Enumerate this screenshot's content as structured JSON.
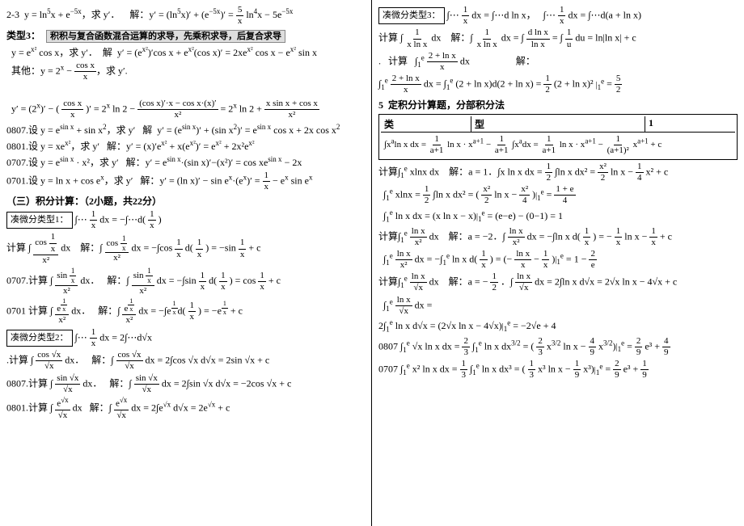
{
  "left": {
    "line1": "2-3  y = ln⁵x + e⁻⁵ˣ，求 y′．",
    "line1_ans": "解：y′ = (ln⁵x)′ + (e⁻⁵ˣ)′ = (5/x)ln⁴x − 5e⁻⁵ˣ",
    "section3_label": "类型3：",
    "section3_desc": "积积与复合函数混合运算的求导，先乘积求导，后复合求导",
    "line2": "y = eˣ² cos x，求 y′．",
    "line2_ans": "解：y′ = (eˣ²)′cos x + eˣ²(cos x)′ = 2xeˣ² cos x − eˣ² sin x",
    "line3": "其他：y = 2ˣ − cos x / x，求 y′.",
    "section_integ": "（三）积分计算：（2小题，共22分）",
    "type1_label": "凑微分类型1：",
    "type1_formula": "∫⋯(1/x)dx = −∫⋯d(1/x)",
    "calc1_q": "计算 ∫(cos(1/x)/x²)dx",
    "calc1_ans": "解：∫(cos(1/x)/x²)dx = −∫cos(1/x)d(1/x) = −sin(1/x) + c",
    "q0707": "0707.计算 ∫(sin(1/x)/x²)dx．",
    "q0707_ans": "解：∫(sin(1/x)/x²)dx = −∫sin(1/x)d(1/x) = cos(1/x) + c",
    "q0701": "0701 计算 ∫(e^(1/x)/x²)dx．",
    "q0701_ans": "解：∫(e^(1/x)/x²)dx = −∫e^(1/x)d(1/x) = −e^(1/x) + c",
    "type2_label": "凑微分类型2：",
    "type2_formula": "∫⋯(1/x)dx = 2∫⋯d√x",
    "calc2_q": "计算 ∫(cos√x/√x)dx．",
    "calc2_ans": "解：∫(cos√x/√x)dx = 2∫cos√x d√x = 2sin√x + c",
    "q0807": "0807.计算 ∫(sin√x/√x)dx．",
    "q0807_ans": "解：∫(sin√x/√x)dx = 2∫sin√x d√x = −2cos√x + c",
    "q0801": "0801.计算 ∫(e^√x/√x)dx",
    "q0801_ans": "解：∫(e^√x/√x)dx = 2∫e^√x d√x = 2e^√x + c"
  },
  "right": {
    "type3_label": "凑微分类型3：",
    "type3_formula": "∫⋯(1/x)dx = ∫⋯d ln x，  ∫⋯(1/x)dx = ∫⋯d(a + ln x)",
    "calc3_q": "计算 ∫(1/xlnx)dx",
    "calc3_ans": "解：∫(1/xlnx)dx = ∫(d ln x / ln x) = ∫(1/u)du = ln|ln x| + c",
    "calc3_q2": "计算 ∫₁ᵉ (2 + ln x)/x dx",
    "calc3_ans2": "解：",
    "calc3_ans2_detail": "∫₁ᵉ (2+ln x)/x dx = ∫₁ᵉ (2+ln x)d(2+ln x) = (1/2)(2+ln x)²|₁ᵉ = 5/2",
    "section5_label": "5  定积分计算题，分部积分法",
    "table_header": [
      "类",
      "型",
      "1"
    ],
    "formula_main": "∫xⁿ ln x dx = (1/(a+1))ln x · x^(a+1) − (1/(a+1))∫xⁿdx = (1/(a+1))ln x · x^(a+1) − (1/((a+1)²))x^(a+1) + c",
    "calc_xlnx_q": "计算∫₁ᵉ xlnx dx",
    "calc_xlnx_ans": "解：a = 1．∫x ln x dx = (1/2)∫ln x dx² = (x²/2)ln x − (1/4)x² + c",
    "calc_xlnx_detail": "∫₁ᵉ xlnx = (1/2)∫ln x dx² = (x²/2 ln x − x²/4)|₁ᵉ = (1+e)/4",
    "calc_int_e_q": "∫ᵉ ln x dx = (x ln x − x)|₁ᵉ = (e−e) − (0−1) = 1",
    "calc_lnx_x2_q": "计算∫₁ᵉ (ln x/x²)dx",
    "calc_lnx_x2_ans": "解：a = −2．∫(ln x/x²)dx = −∫ln x d(1/x) = −(1/x)ln x − (1/x) + c",
    "calc_lnx_x2_detail": "∫₁ᵉ (ln x/x²)dx = −∫₁ᵉ ln x d(1/x) = (−ln x/x − 1/x)|₁ᵉ = 1 − 2/e",
    "calc_lnx_sqx_q": "计算∫₁ᵉ (ln x/√x)dx",
    "calc_lnx_sqx_ans": "解：a = −1/2．∫(ln x/√x)dx = 2∫ln x d√x = 2√x ln x − 4√x + c",
    "calc_lnx_sqx_detail": "∫₁ᵉ (ln x/√x)dx =",
    "calc_lnx_sqx_detail2": "2∫₁ᵉ ln x d√x = (2√x ln x − 4√x)|₁ᵉ = −2√e + 4",
    "q0807_right": "0807 ∫₁ᵉ √x ln x dx = (2/3)∫₁ᵉ ln x dx^(3/2) = ((2/3)x^(3/2) ln x − (4/9)x^(3/2))|₁ᵉ = (2/9)e³ + 4/9",
    "q0707_right": "0707 ∫₁ᵉ x² ln x dx = (1/3)∫₁ᵉ ln x dx³ = ((1/3)x³ ln x − (1/9)x³)|₁ᵉ = (2/9)e³ + 1/9"
  }
}
